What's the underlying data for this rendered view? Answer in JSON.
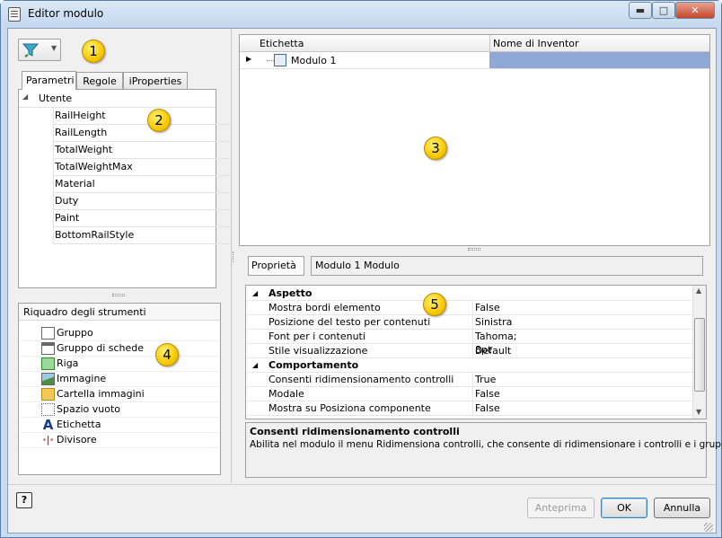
{
  "window": {
    "title": "Editor modulo",
    "min_glyph": "▬",
    "max_glyph": "□",
    "close_glyph": "✕"
  },
  "left": {
    "filter_tooltip_icon": "filter-icon",
    "tabs": [
      "Parametri",
      "Regole",
      "iProperties"
    ],
    "group_label": "Utente",
    "parameters": [
      "RailHeight",
      "RailLength",
      "TotalWeight",
      "TotalWeightMax",
      "Material",
      "Duty",
      "Paint",
      "BottomRailStyle"
    ]
  },
  "toolbox": {
    "title": "Riquadro degli strumenti",
    "items": [
      {
        "label": "Gruppo",
        "icon": "group-icon"
      },
      {
        "label": "Gruppo di schede",
        "icon": "tab-group-icon"
      },
      {
        "label": "Riga",
        "icon": "row-icon"
      },
      {
        "label": "Immagine",
        "icon": "image-icon"
      },
      {
        "label": "Cartella immagini",
        "icon": "image-folder-icon"
      },
      {
        "label": "Spazio vuoto",
        "icon": "empty-space-icon"
      },
      {
        "label": "Etichetta",
        "icon": "label-icon"
      },
      {
        "label": "Divisore",
        "icon": "divider-icon"
      }
    ]
  },
  "tree": {
    "columns": [
      "Etichetta",
      "Nome di Inventor"
    ],
    "row_label": "Modulo 1"
  },
  "properties": {
    "header_label": "Proprietà",
    "header_value": "Modulo 1 Modulo",
    "categories": [
      {
        "name": "Aspetto",
        "rows": [
          {
            "key": "Mostra bordi elemento",
            "value": "False"
          },
          {
            "key": "Posizione del testo per contenuti",
            "value": "Sinistra"
          },
          {
            "key": "Font per i contenuti",
            "value": "Tahoma; 8pt"
          },
          {
            "key": "Stile visualizzazione",
            "value": "Default"
          }
        ]
      },
      {
        "name": "Comportamento",
        "rows": [
          {
            "key": "Consenti ridimensionamento controlli",
            "value": "True"
          },
          {
            "key": "Modale",
            "value": "False"
          },
          {
            "key": "Mostra su Posiziona componente",
            "value": "False"
          }
        ]
      }
    ],
    "desc_title": "Consenti ridimensionamento controlli",
    "desc_text": "Abilita nel modulo il menu Ridimensiona controlli, che consente di ridimensionare i controlli e i gruppi."
  },
  "footer": {
    "help": "?",
    "preview": "Anteprima",
    "ok": "OK",
    "cancel": "Annulla"
  },
  "callouts": [
    "1",
    "2",
    "3",
    "4",
    "5"
  ]
}
